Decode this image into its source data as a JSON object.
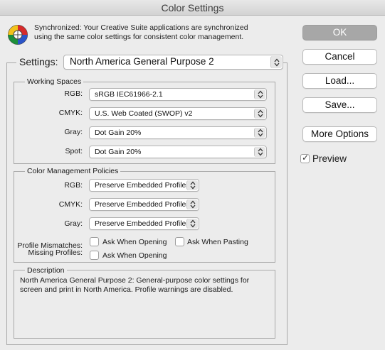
{
  "window": {
    "title": "Color Settings"
  },
  "sync": {
    "icon": "color-wheel-icon",
    "line1": "Synchronized: Your Creative Suite applications are synchronized",
    "line2": "using the same color settings for consistent color management."
  },
  "buttons": {
    "ok": "OK",
    "cancel": "Cancel",
    "load": "Load...",
    "save": "Save...",
    "more_options": "More Options"
  },
  "preview": {
    "label": "Preview",
    "checked": true
  },
  "settings": {
    "label": "Settings:",
    "value": "North America General Purpose 2"
  },
  "working_spaces": {
    "title": "Working Spaces",
    "rows": [
      {
        "label": "RGB:",
        "value": "sRGB IEC61966-2.1"
      },
      {
        "label": "CMYK:",
        "value": "U.S. Web Coated (SWOP) v2"
      },
      {
        "label": "Gray:",
        "value": "Dot Gain 20%"
      },
      {
        "label": "Spot:",
        "value": "Dot Gain 20%"
      }
    ]
  },
  "policies": {
    "title": "Color Management Policies",
    "rows": [
      {
        "label": "RGB:",
        "value": "Preserve Embedded Profiles"
      },
      {
        "label": "CMYK:",
        "value": "Preserve Embedded Profiles"
      },
      {
        "label": "Gray:",
        "value": "Preserve Embedded Profiles"
      }
    ],
    "profile_mismatches_label": "Profile Mismatches:",
    "missing_profiles_label": "Missing Profiles:",
    "ask_when_opening_mismatch": "Ask When Opening",
    "ask_when_pasting": "Ask When Pasting",
    "ask_when_opening_missing": "Ask When Opening"
  },
  "description": {
    "title": "Description",
    "text": "North America General Purpose 2:  General-purpose color settings for screen and print in North America. Profile warnings are disabled."
  }
}
